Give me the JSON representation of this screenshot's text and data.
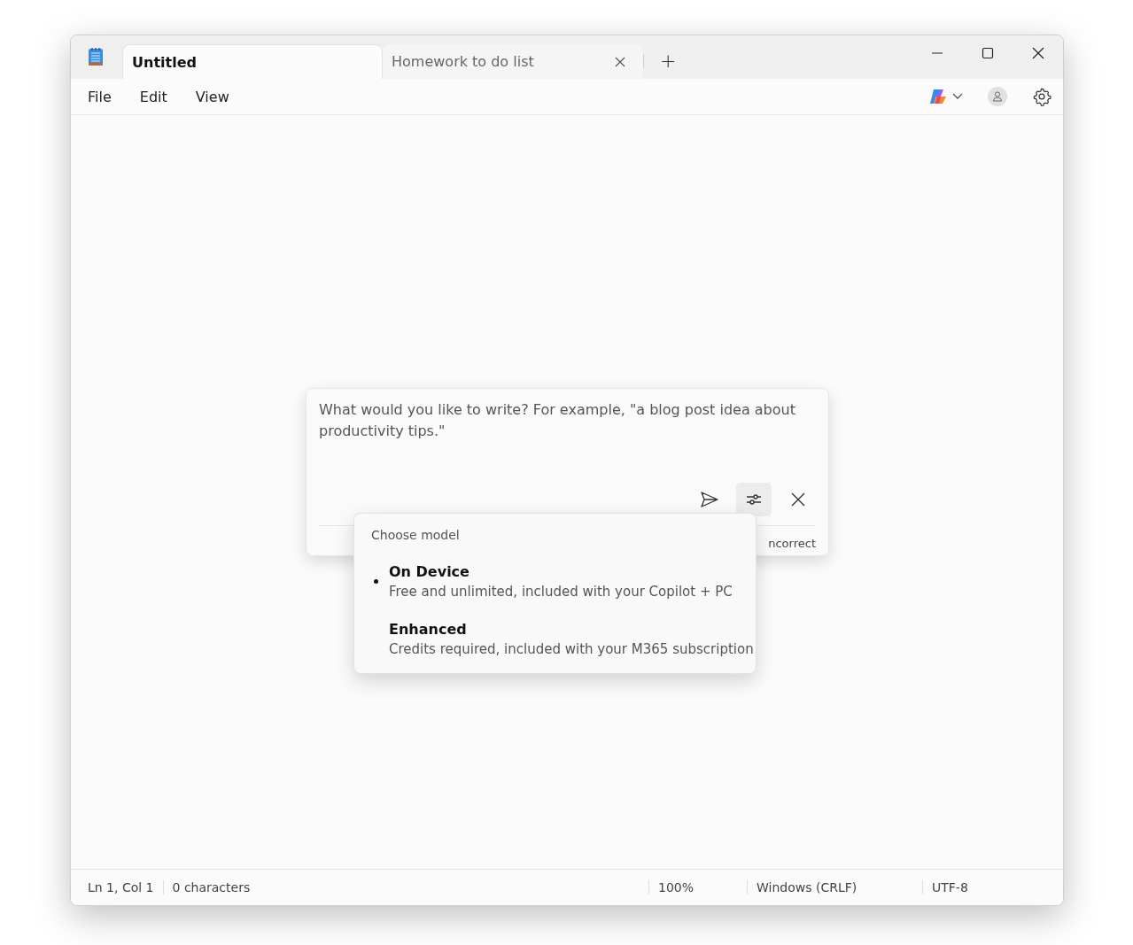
{
  "tabs": [
    {
      "label": "Untitled",
      "selected": true
    },
    {
      "label": "Homework to do list",
      "selected": false
    }
  ],
  "new_tab": "+",
  "menu": [
    "File",
    "Edit",
    "View"
  ],
  "prompt": {
    "placeholder": "What would you like to write? For example, \"a blog post idea about productivity tips.\"",
    "footer_text": "ncorrect"
  },
  "model_menu": {
    "title": "Choose model",
    "options": [
      {
        "name": "On Device",
        "description": "Free and unlimited, included with your Copilot + PC",
        "selected": true
      },
      {
        "name": "Enhanced",
        "description": "Credits required, included with your M365 subscription",
        "selected": false
      }
    ]
  },
  "status_bar": [
    "Ln 1, Col 1",
    "0 characters",
    "100%",
    "Windows (CRLF)",
    "UTF-8"
  ]
}
